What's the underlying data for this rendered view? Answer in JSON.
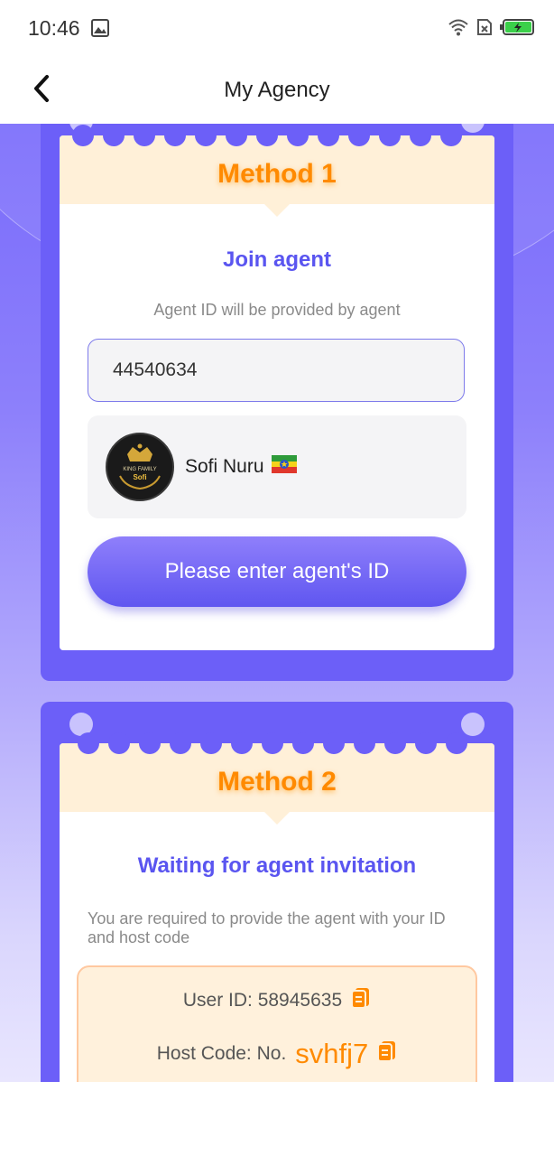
{
  "status_bar": {
    "time": "10:46"
  },
  "header": {
    "title": "My Agency"
  },
  "method1": {
    "label": "Method 1",
    "title": "Join agent",
    "hint": "Agent ID will be provided by agent",
    "input_value": "44540634",
    "agent_name": "Sofi Nuru",
    "avatar_text_top": "KING FAMILY",
    "avatar_text_bottom": "Sofi",
    "button_label": "Please enter agent's ID"
  },
  "method2": {
    "label": "Method 2",
    "title": "Waiting for agent invitation",
    "hint": "You are required to provide the agent with your ID and host code",
    "user_id_label": "User ID: 58945635",
    "host_code_label": "Host Code: No.",
    "host_code_value": "svhfj7"
  },
  "colors": {
    "accent": "#6c5ff8",
    "method_orange": "#ff8a00",
    "title_blue": "#5a55f0"
  }
}
